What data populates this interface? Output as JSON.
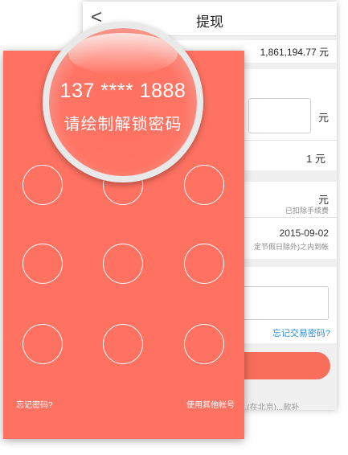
{
  "withdraw": {
    "back_glyph": "<",
    "title": "提现",
    "balance_value": "1,861,194.77 元",
    "amount_unit": "元",
    "fee_value": "1 元",
    "arrive_unit": "元",
    "arrive_note": "已扣除手续费",
    "date_value": "2015-09-02",
    "date_note": "定节假日除外)之内到帐",
    "forgot_trade_password": "忘记交易密码?",
    "bottom_snippet": "...(在北京)...款补"
  },
  "gesture": {
    "phone": "137 **** 1888",
    "prompt": "请绘制解锁密码",
    "forgot_link": "忘记密码?",
    "other_account_link": "使用其他帐号"
  },
  "colors": {
    "primary": "#ff7161",
    "link": "#2e8fd8"
  }
}
